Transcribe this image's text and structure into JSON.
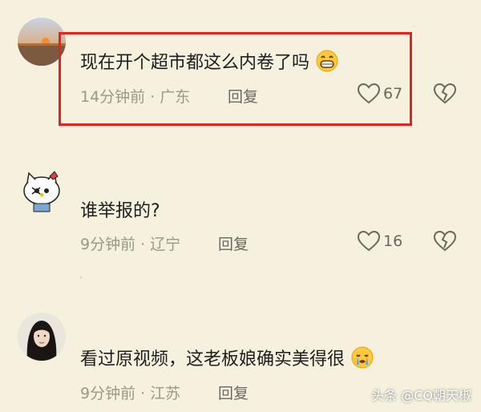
{
  "comments": [
    {
      "text": "现在开个超市都这么内卷了吗",
      "time": "14分钟前",
      "location": "广东",
      "reply": "回复",
      "likes": "67",
      "emoji": "grinning-emoji"
    },
    {
      "text": "谁举报的?",
      "time": "9分钟前",
      "location": "辽宁",
      "reply": "回复",
      "likes": "16"
    },
    {
      "text": "看过原视频，这老板娘确实美得很",
      "time": "9分钟前",
      "location": "江苏",
      "reply": "回复",
      "emoji": "crying-emoji"
    }
  ],
  "separator": "·",
  "watermark": "头条 @CQ朝天椒",
  "colors": {
    "highlight": "#e8211f",
    "background": "#f6f1df"
  }
}
